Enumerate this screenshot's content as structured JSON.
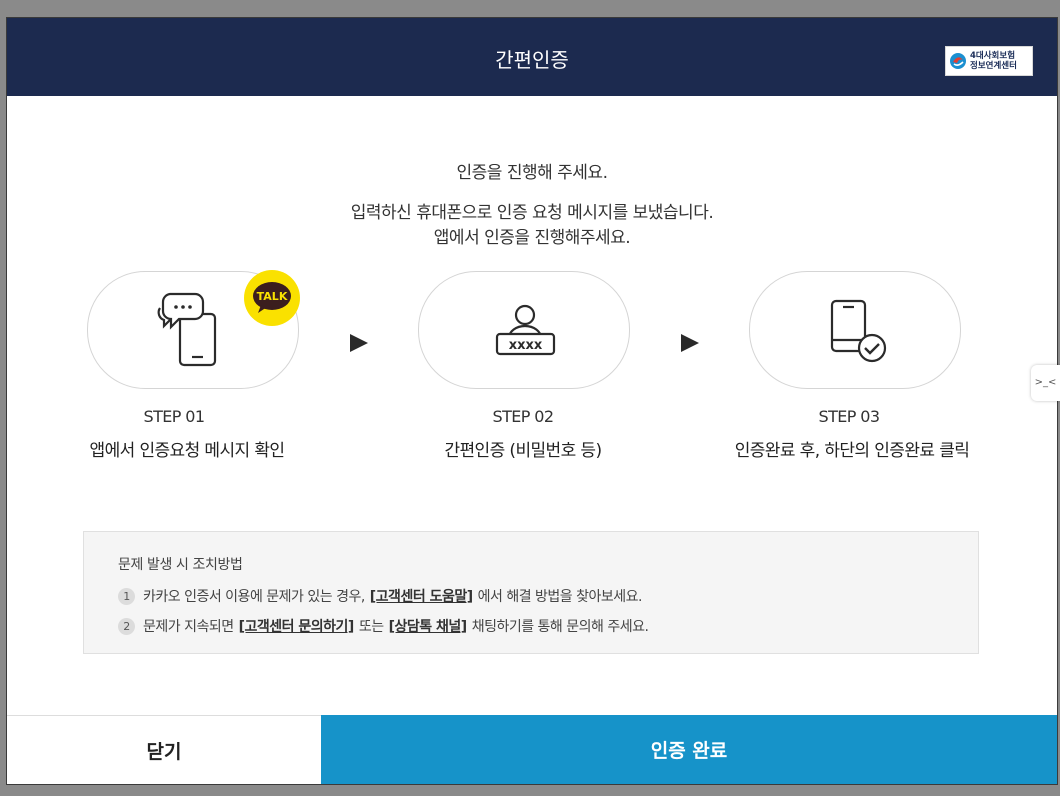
{
  "header": {
    "title": "간편인증",
    "logo_line1": "4대사회보험",
    "logo_line2": "정보연계센터"
  },
  "intro": {
    "line1": "인증을 진행해 주세요.",
    "line2": "입력하신 휴대폰으로 인증 요청 메시지를 보냈습니다.",
    "line3": "앱에서 인증을 진행해주세요."
  },
  "steps": [
    {
      "label": "STEP 01",
      "desc": "앱에서 인증요청 메시지 확인",
      "icon": "phone-chat-icon",
      "badge": "TALK"
    },
    {
      "label": "STEP 02",
      "desc": "간편인증 (비밀번호 등)",
      "icon": "user-password-icon"
    },
    {
      "label": "STEP 03",
      "desc": "인증완료 후, 하단의 인증완료 클릭",
      "icon": "phone-check-icon"
    }
  ],
  "notice": {
    "title": "문제 발생 시 조치방법",
    "items": [
      {
        "num": "1",
        "pre": "카카오 인증서 이용에 문제가 있는 경우,",
        "link": "[고객센터 도움말]",
        "post": "에서 해결 방법을 찾아보세요."
      },
      {
        "num": "2",
        "pre": "문제가 지속되면",
        "link": "[고객센터 문의하기]",
        "mid": "또는",
        "link2": "[상담톡 채널]",
        "post": "채팅하기를 통해 문의해 주세요."
      }
    ]
  },
  "footer": {
    "close_label": "닫기",
    "done_label": "인증 완료"
  },
  "side_tab": {
    "label": ">_<"
  },
  "colors": {
    "header_bg": "#1c2a4f",
    "primary": "#1693c9",
    "kakao": "#fae100"
  }
}
